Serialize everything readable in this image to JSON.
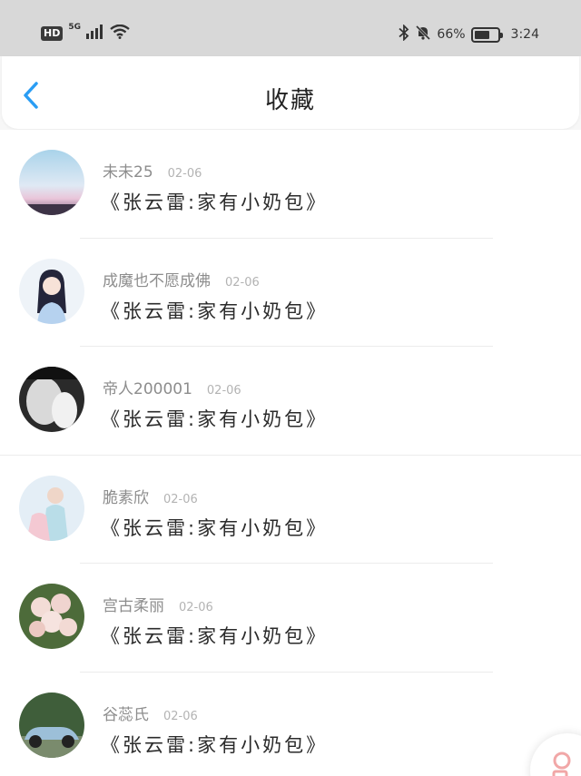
{
  "status_bar": {
    "hd": "HD",
    "network": "5G",
    "battery_pct_text": "66%",
    "battery_level": 0.66,
    "time": "3:24"
  },
  "header": {
    "title": "收藏"
  },
  "items": [
    {
      "username": "未未25",
      "date": "02-06",
      "content": "《张云雷:家有小奶包》"
    },
    {
      "username": "成魔也不愿成佛",
      "date": "02-06",
      "content": "《张云雷:家有小奶包》"
    },
    {
      "username": "帝人200001",
      "date": "02-06",
      "content": "《张云雷:家有小奶包》"
    },
    {
      "username": "脆素欣",
      "date": "02-06",
      "content": "《张云雷:家有小奶包》"
    },
    {
      "username": "宫古柔丽",
      "date": "02-06",
      "content": "《张云雷:家有小奶包》"
    },
    {
      "username": "谷蕊氏",
      "date": "02-06",
      "content": "《张云雷:家有小奶包》"
    }
  ],
  "colors": {
    "accent": "#2a9df4",
    "status_bar_bg": "#d8d8d8",
    "username": "#8d8d8d",
    "date": "#b3b3b3"
  },
  "icons": {
    "back": "chevron-left-icon",
    "bluetooth": "bluetooth-icon",
    "mute": "bell-off-icon",
    "wifi": "wifi-icon",
    "signal": "signal-icon",
    "battery": "battery-icon",
    "floating": "floating-action-icon"
  }
}
